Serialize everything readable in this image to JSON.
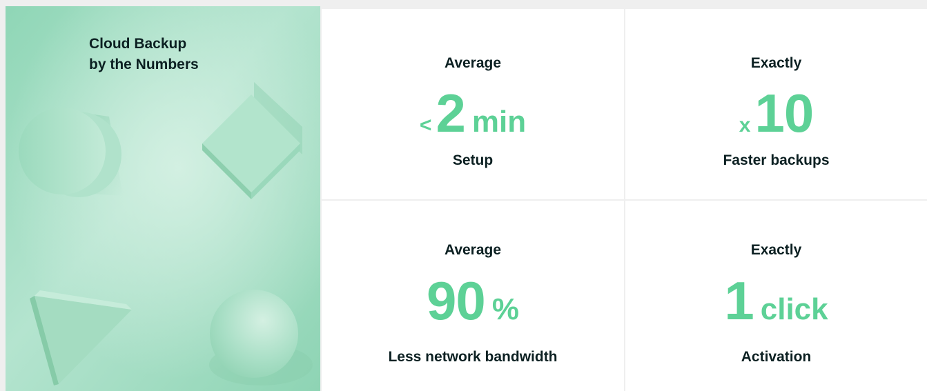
{
  "hero": {
    "title_line1": "Cloud Backup",
    "title_line2": "by the Numbers",
    "background_color": "#9fdcc0"
  },
  "accent_color": "#5dd196",
  "text_color": "#0c2022",
  "stats": [
    {
      "eyebrow": "Average",
      "prefix": "<",
      "value": "2",
      "unit": "min",
      "caption": "Setup"
    },
    {
      "eyebrow": "Exactly",
      "prefix": "x",
      "value": "10",
      "unit": "",
      "caption": "Faster backups"
    },
    {
      "eyebrow": "Average",
      "prefix": "",
      "value": "90",
      "unit": "%",
      "caption": "Less network bandwidth"
    },
    {
      "eyebrow": "Exactly",
      "prefix": "",
      "value": "1",
      "unit": "click",
      "caption": "Activation"
    }
  ]
}
